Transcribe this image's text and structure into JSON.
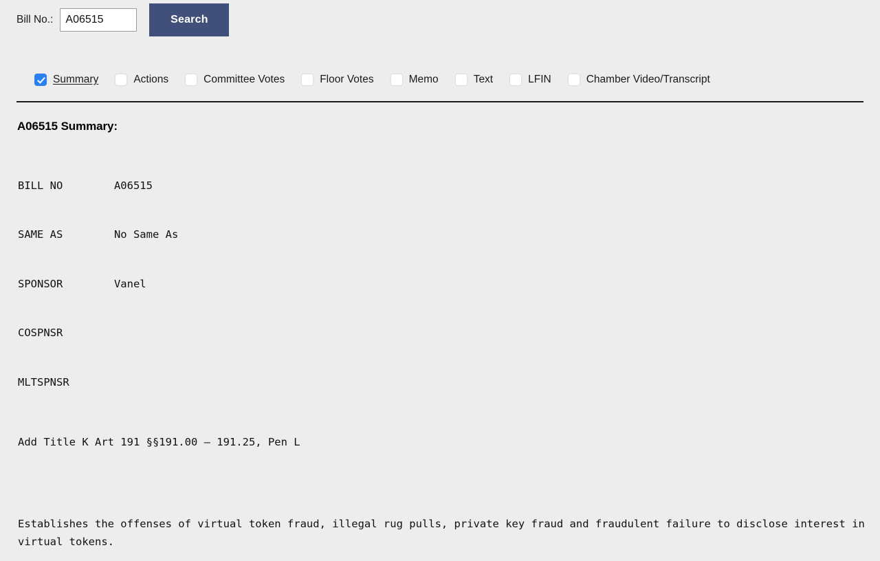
{
  "search": {
    "label": "Bill No.:",
    "value": "A06515",
    "placeholder": "Bill No.",
    "button_label": "Search"
  },
  "tabs": [
    {
      "label": "Summary",
      "checked": true,
      "link": true
    },
    {
      "label": "Actions",
      "checked": false,
      "link": false
    },
    {
      "label": "Committee Votes",
      "checked": false,
      "link": false
    },
    {
      "label": "Floor Votes",
      "checked": false,
      "link": false
    },
    {
      "label": "Memo",
      "checked": false,
      "link": false
    },
    {
      "label": "Text",
      "checked": false,
      "link": false
    },
    {
      "label": "LFIN",
      "checked": false,
      "link": false
    },
    {
      "label": "Chamber Video/Transcript",
      "checked": false,
      "link": false
    }
  ],
  "summary": {
    "heading": "A06515 Summary:",
    "rows": [
      {
        "field": "BILL NO",
        "value": "A06515"
      },
      {
        "field": "SAME AS",
        "value": "No Same As"
      },
      {
        "field": "SPONSOR",
        "value": "Vanel"
      },
      {
        "field": "COSPNSR",
        "value": ""
      },
      {
        "field": "MLTSPNSR",
        "value": ""
      }
    ],
    "law_reference": "Add Title K Art 191 §§191.00 — 191.25, Pen L",
    "description": "Establishes the offenses of virtual token fraud, illegal rug pulls, private key fraud and fraudulent failure to disclose interest in virtual tokens."
  },
  "colors": {
    "page_background": "#ededed",
    "button_background": "#41507a",
    "checkbox_checked": "#2b7fef",
    "divider": "#1c1c1c"
  }
}
